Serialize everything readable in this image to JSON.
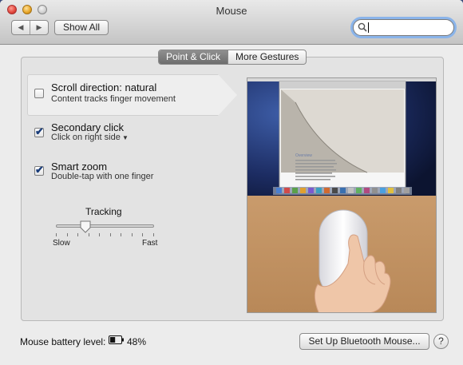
{
  "window": {
    "title": "Mouse",
    "back_icon": "chevron-left-icon",
    "forward_icon": "chevron-right-icon",
    "show_all_label": "Show All",
    "search": {
      "value": "",
      "placeholder": ""
    }
  },
  "tabs": [
    {
      "label": "Point & Click",
      "selected": true
    },
    {
      "label": "More Gestures",
      "selected": false
    }
  ],
  "options": [
    {
      "title": "Scroll direction: natural",
      "subtitle": "Content tracks finger movement",
      "checked": false
    },
    {
      "title": "Secondary click",
      "subtitle": "Click on right side",
      "checked": true
    },
    {
      "title": "Smart zoom",
      "subtitle": "Double-tap with one finger",
      "checked": true
    }
  ],
  "tracking": {
    "label": "Tracking",
    "min_label": "Slow",
    "max_label": "Fast",
    "value": 0.3,
    "tick_count": 10
  },
  "preview": {
    "document_heading": "Overview",
    "description": "video of hand scrolling on Magic Mouse"
  },
  "footer": {
    "battery_label": "Mouse battery level:",
    "battery_value": "48%",
    "battery_icon": "battery-icon",
    "setup_button_label": "Set Up Bluetooth Mouse...",
    "help_label": "?"
  },
  "colors": {
    "accent_focus": "#8ab4ea",
    "selected_tab": "#7a7a7a",
    "checkmark": "#1a3d7a"
  }
}
